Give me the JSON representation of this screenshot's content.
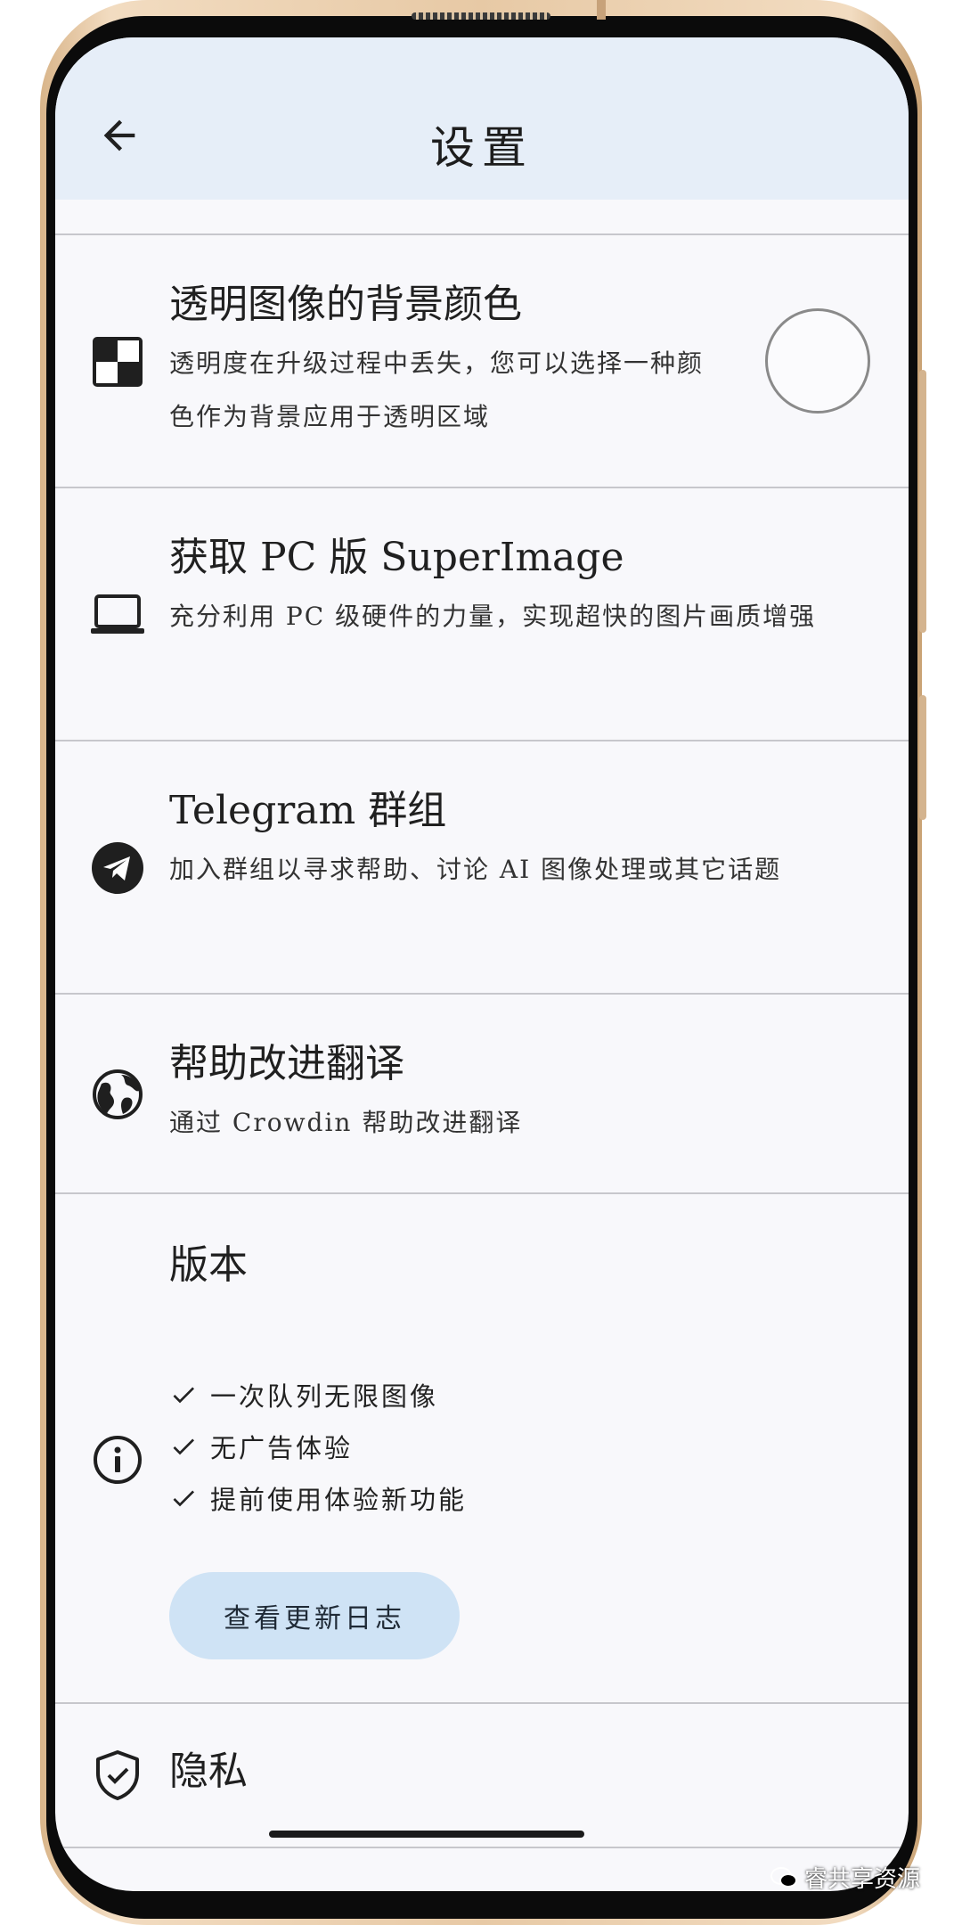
{
  "app_bar": {
    "title": "设置"
  },
  "settings": [
    {
      "title": "透明图像的背景颜色",
      "subtitle": "透明度在升级过程中丢失，您可以选择一种颜色作为背景应用于透明区域",
      "icon": "transparency-checker-icon"
    },
    {
      "title": "获取 PC 版 SuperImage",
      "subtitle": "充分利用 PC 级硬件的力量，实现超快的图片画质增强",
      "icon": "laptop-icon"
    },
    {
      "title": "Telegram 群组",
      "subtitle": "加入群组以寻求帮助、讨论 AI 图像处理或其它话题",
      "icon": "telegram-icon"
    },
    {
      "title": "帮助改进翻译",
      "subtitle": "通过 Crowdin 帮助改进翻译",
      "icon": "globe-icon"
    }
  ],
  "version": {
    "title": "版本",
    "features": [
      "一次队列无限图像",
      "无广告体验",
      "提前使用体验新功能"
    ],
    "changelog_button": "查看更新日志",
    "icon": "info-icon"
  },
  "privacy": {
    "title": "隐私",
    "icon": "shield-check-icon"
  },
  "watermark": {
    "text": "睿共享资源"
  },
  "colors": {
    "app_bar_bg": "#e6eef8",
    "button_bg": "#cfe3f5",
    "screen_bg": "#f8f8fb"
  }
}
